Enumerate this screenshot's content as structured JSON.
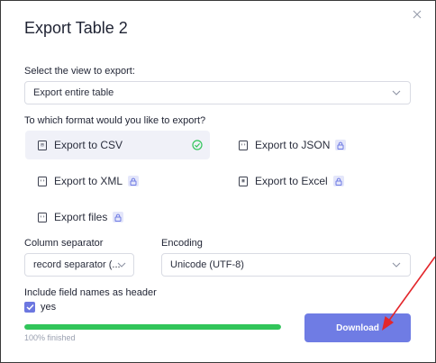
{
  "dialog": {
    "title": "Export Table 2",
    "view_label": "Select the view to export:",
    "view_value": "Export entire table",
    "format_label": "To which format would you like to export?",
    "formats": [
      {
        "label": "Export to CSV",
        "icon": "csv-file-icon",
        "icon_text": "CSV",
        "selected": true,
        "locked": false
      },
      {
        "label": "Export to JSON",
        "icon": "json-file-icon",
        "icon_text": "</>",
        "selected": false,
        "locked": true
      },
      {
        "label": "Export to XML",
        "icon": "xml-file-icon",
        "icon_text": "</>",
        "selected": false,
        "locked": true
      },
      {
        "label": "Export to Excel",
        "icon": "excel-file-icon",
        "icon_text": "XLS",
        "selected": false,
        "locked": true
      },
      {
        "label": "Export files",
        "icon": "files-icon",
        "icon_text": "</>",
        "selected": false,
        "locked": true
      }
    ],
    "separator_label": "Column separator",
    "separator_value": "record separator (...",
    "encoding_label": "Encoding",
    "encoding_value": "Unicode (UTF-8)",
    "header_label": "Include field names as header",
    "header_checkbox_label": "yes",
    "header_checked": true,
    "progress_fraction": 1.0,
    "progress_text": "100% finished",
    "download_label": "Download"
  },
  "colors": {
    "accent": "#6f7ce4",
    "progress": "#31c55a",
    "selected_bg": "#f0f1f8",
    "annotation_arrow": "#e3262b"
  }
}
